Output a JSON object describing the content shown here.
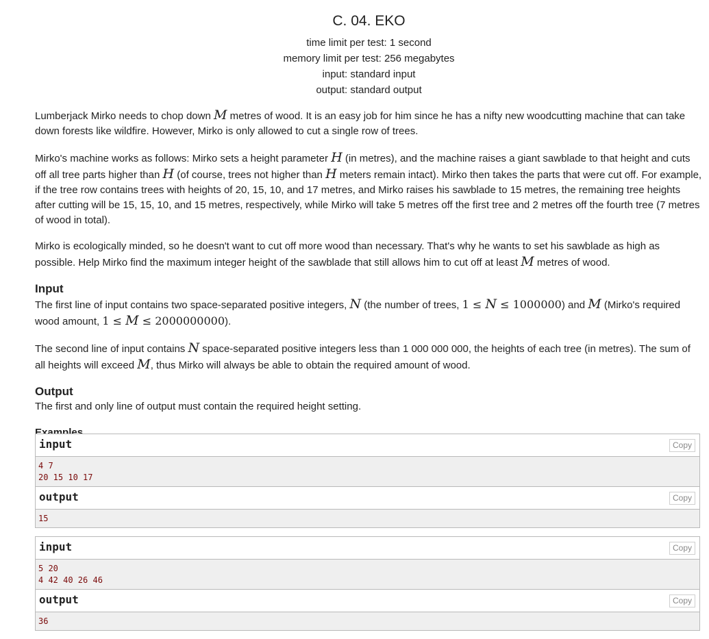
{
  "problem": {
    "title": "C. 04. EKO",
    "time_limit": "time limit per test: 1 second",
    "memory_limit": "memory limit per test: 256 megabytes",
    "input_file": "input: standard input",
    "output_file": "output: standard output"
  },
  "legend": {
    "p1_a": "Lumberjack Mirko needs to chop down ",
    "var_M": "M",
    "p1_b": " metres of wood. It is an easy job for him since he has a nifty new woodcutting machine that can take down forests like wildfire. However, Mirko is only allowed to cut a single row of trees.",
    "p2_a": "Mirko's machine works as follows: Mirko sets a height parameter ",
    "var_H": "H",
    "p2_b": " (in metres), and the machine raises a giant sawblade to that height and cuts off all tree parts higher than ",
    "p2_c": " (of course, trees not higher than ",
    "p2_d": " meters remain intact). Mirko then takes the parts that were cut off. For example, if the tree row contains trees with heights of 20, 15, 10, and 17 metres, and Mirko raises his sawblade to 15 metres, the remaining tree heights after cutting will be 15, 15, 10, and 15 metres, respectively, while Mirko will take 5 metres off the first tree and 2 metres off the fourth tree (7 metres of wood in total).",
    "p3_a": "Mirko is ecologically minded, so he doesn't want to cut off more wood than necessary. That's why he wants to set his sawblade as high as possible. Help Mirko find the maximum integer height of the sawblade that still allows him to cut off at least ",
    "p3_b": " metres of wood."
  },
  "input_section": {
    "heading": "Input",
    "l1_a": "The first line of input contains two space-separated positive integers, ",
    "var_N": "N",
    "l1_b": " (the number of trees, ",
    "n_one": "1",
    "leq": " ≤ ",
    "n_max": "1000000",
    "l1_c": ") and ",
    "l1_d": " (Mirko's required wood amount, ",
    "m_max": "2000000000",
    "l1_e": ").",
    "l2_a": "The second line of input contains ",
    "l2_b": " space-separated positive integers less than 1 000 000 000, the heights of each tree (in metres). The sum of all heights will exceed ",
    "l2_c": ", thus Mirko will always be able to obtain the required amount of wood."
  },
  "output_section": {
    "heading": "Output",
    "text": "The first and only line of output must contain the required height setting."
  },
  "examples": {
    "heading": "Examples",
    "input_label": "input",
    "output_label": "output",
    "copy_label": "Copy",
    "ex1_input": "4 7\n20 15 10 17",
    "ex1_output": "15",
    "ex2_input": "5 20\n4 42 40 26 46",
    "ex2_output": "36"
  }
}
